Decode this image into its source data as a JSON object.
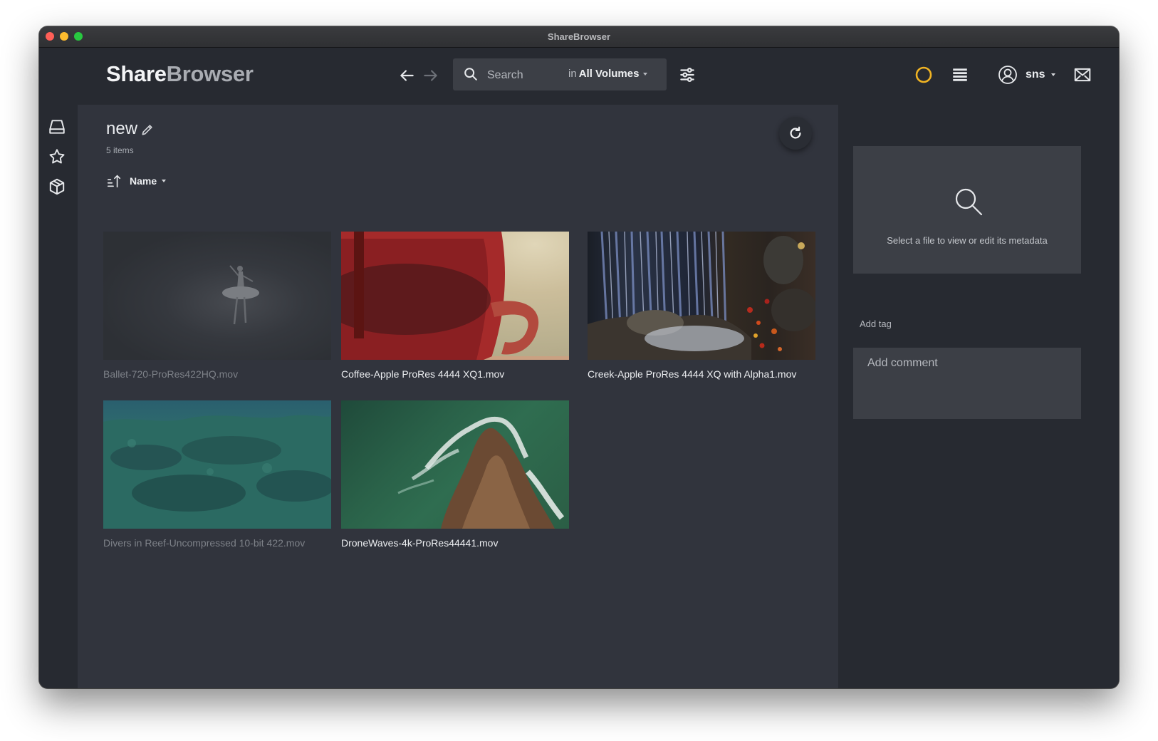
{
  "window": {
    "title": "ShareBrowser"
  },
  "header": {
    "logo_part1": "Share",
    "logo_part2": "Browser",
    "search": {
      "placeholder": "Search",
      "scope_prefix": "in",
      "scope_value": "All Volumes"
    },
    "user": {
      "name": "sns"
    }
  },
  "colors": {
    "accent_activity": "#f0b323",
    "background_main": "#31343d",
    "background_panel": "#272a31"
  },
  "leftrail": {
    "items": [
      {
        "icon": "drive-icon"
      },
      {
        "icon": "star-icon"
      },
      {
        "icon": "package-icon"
      }
    ]
  },
  "main": {
    "folder_title": "new",
    "item_count": "5 items",
    "sort_label": "Name",
    "files": [
      {
        "name": "Ballet-720-ProRes422HQ.mov",
        "dimmed": true
      },
      {
        "name": "Coffee-Apple ProRes 4444 XQ1.mov",
        "dimmed": false
      },
      {
        "name": "Creek-Apple ProRes 4444 XQ with Alpha1.mov",
        "dimmed": false
      },
      {
        "name": "Divers in Reef-Uncompressed 10-bit 422.mov",
        "dimmed": true
      },
      {
        "name": "DroneWaves-4k-ProRes44441.mov",
        "dimmed": false
      }
    ]
  },
  "rightpanel": {
    "metadata_hint": "Select a file to view or edit its metadata",
    "add_tag": "Add tag",
    "comment_placeholder": "Add comment"
  }
}
